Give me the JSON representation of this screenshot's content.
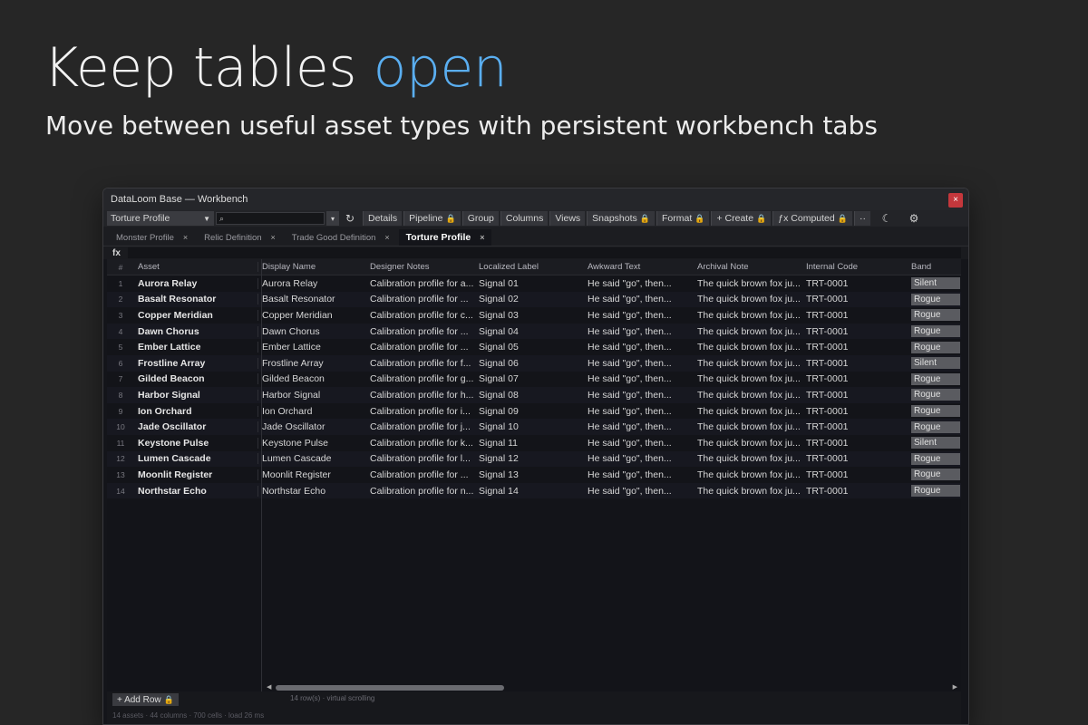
{
  "hero": {
    "title_main": "Keep tables ",
    "title_accent": "open",
    "subtitle": "Move between useful asset types with persistent workbench tabs"
  },
  "window": {
    "title": "DataLoom Base — Workbench",
    "close_label": "×"
  },
  "toolbar": {
    "profile_select": "Torture Profile",
    "search_placeholder": "",
    "buttons": [
      {
        "label": "Details",
        "locked": false
      },
      {
        "label": "Pipeline",
        "locked": true
      },
      {
        "label": "Group",
        "locked": false
      },
      {
        "label": "Columns",
        "locked": false
      },
      {
        "label": "Views",
        "locked": false
      },
      {
        "label": "Snapshots",
        "locked": true
      },
      {
        "label": "Format",
        "locked": true
      },
      {
        "label": "+ Create",
        "locked": true
      },
      {
        "label": "ƒx Computed",
        "locked": true
      },
      {
        "label": "··",
        "locked": false
      }
    ]
  },
  "tabs": [
    {
      "label": "Monster Profile",
      "active": false
    },
    {
      "label": "Relic Definition",
      "active": false
    },
    {
      "label": "Trade Good Definition",
      "active": false
    },
    {
      "label": "Torture Profile",
      "active": true
    }
  ],
  "formula": {
    "label": "fx"
  },
  "grid": {
    "headers": [
      "#",
      "Asset",
      "Display Name",
      "Designer Notes",
      "Localized Label",
      "Awkward Text",
      "Archival Note",
      "Internal Code",
      "Band"
    ],
    "rows": [
      [
        "1",
        "Aurora Relay",
        "Aurora Relay",
        "Calibration profile for a...",
        "Signal 01",
        "He said \"go\", then...",
        "The quick brown fox ju...",
        "TRT-0001",
        "Silent"
      ],
      [
        "2",
        "Basalt Resonator",
        "Basalt Resonator",
        "Calibration profile for ...",
        "Signal 02",
        "He said \"go\", then...",
        "The quick brown fox ju...",
        "TRT-0001",
        "Rogue"
      ],
      [
        "3",
        "Copper Meridian",
        "Copper Meridian",
        "Calibration profile for c...",
        "Signal 03",
        "He said \"go\", then...",
        "The quick brown fox ju...",
        "TRT-0001",
        "Rogue"
      ],
      [
        "4",
        "Dawn Chorus",
        "Dawn Chorus",
        "Calibration profile for ...",
        "Signal 04",
        "He said \"go\", then...",
        "The quick brown fox ju...",
        "TRT-0001",
        "Rogue"
      ],
      [
        "5",
        "Ember Lattice",
        "Ember Lattice",
        "Calibration profile for ...",
        "Signal 05",
        "He said \"go\", then...",
        "The quick brown fox ju...",
        "TRT-0001",
        "Rogue"
      ],
      [
        "6",
        "Frostline Array",
        "Frostline Array",
        "Calibration profile for f...",
        "Signal 06",
        "He said \"go\", then...",
        "The quick brown fox ju...",
        "TRT-0001",
        "Silent"
      ],
      [
        "7",
        "Gilded Beacon",
        "Gilded Beacon",
        "Calibration profile for g...",
        "Signal 07",
        "He said \"go\", then...",
        "The quick brown fox ju...",
        "TRT-0001",
        "Rogue"
      ],
      [
        "8",
        "Harbor Signal",
        "Harbor Signal",
        "Calibration profile for h...",
        "Signal 08",
        "He said \"go\", then...",
        "The quick brown fox ju...",
        "TRT-0001",
        "Rogue"
      ],
      [
        "9",
        "Ion Orchard",
        "Ion Orchard",
        "Calibration profile for i...",
        "Signal 09",
        "He said \"go\", then...",
        "The quick brown fox ju...",
        "TRT-0001",
        "Rogue"
      ],
      [
        "10",
        "Jade Oscillator",
        "Jade Oscillator",
        "Calibration profile for j...",
        "Signal 10",
        "He said \"go\", then...",
        "The quick brown fox ju...",
        "TRT-0001",
        "Rogue"
      ],
      [
        "11",
        "Keystone Pulse",
        "Keystone Pulse",
        "Calibration profile for k...",
        "Signal 11",
        "He said \"go\", then...",
        "The quick brown fox ju...",
        "TRT-0001",
        "Silent"
      ],
      [
        "12",
        "Lumen Cascade",
        "Lumen Cascade",
        "Calibration profile for l...",
        "Signal 12",
        "He said \"go\", then...",
        "The quick brown fox ju...",
        "TRT-0001",
        "Rogue"
      ],
      [
        "13",
        "Moonlit Register",
        "Moonlit Register",
        "Calibration profile for ...",
        "Signal 13",
        "He said \"go\", then...",
        "The quick brown fox ju...",
        "TRT-0001",
        "Rogue"
      ],
      [
        "14",
        "Northstar Echo",
        "Northstar Echo",
        "Calibration profile for n...",
        "Signal 14",
        "He said \"go\", then...",
        "The quick brown fox ju...",
        "TRT-0001",
        "Rogue"
      ]
    ]
  },
  "footer": {
    "add_row": "+ Add Row",
    "status": "14 row(s) · virtual scrolling",
    "stats": "14 assets · 44 columns · 700 cells · load 26 ms"
  },
  "colors": {
    "accent": "#5aaef0",
    "lock": "#e8b73a",
    "close": "#c4373c"
  }
}
